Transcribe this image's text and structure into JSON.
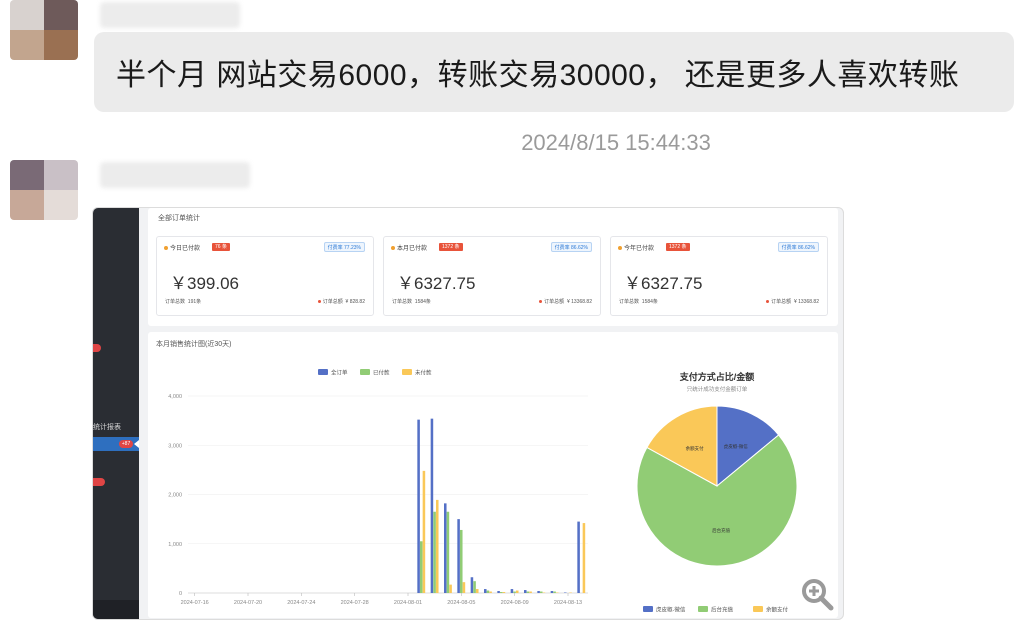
{
  "chat": {
    "message_text": "半个月 网站交易6000，转账交易30000， 还是更多人喜欢转账",
    "timestamp": "2024/8/15 15:44:33"
  },
  "screenshot": {
    "top_panel_title": "全部订单统计",
    "cards": [
      {
        "label": "今日已付款",
        "badge": "76 条",
        "rate": "付费率 77.23%",
        "amount": "￥399.06",
        "count_label": "订单总数",
        "count_value": "191条",
        "total_label": "订单总额",
        "total_value": "¥ 828.82"
      },
      {
        "label": "本月已付款",
        "badge": "1372 条",
        "rate": "付费率 86.62%",
        "amount": "￥6327.75",
        "count_label": "订单总数",
        "count_value": "1584条",
        "total_label": "订单总额",
        "total_value": "¥ 13368.82"
      },
      {
        "label": "今年已付款",
        "badge": "1372 条",
        "rate": "付费率 86.62%",
        "amount": "￥6327.75",
        "count_label": "订单总数",
        "count_value": "1584条",
        "total_label": "订单总额",
        "total_value": "¥ 13368.82"
      }
    ],
    "chart_panel_title": "本月销售统计图(近30天)",
    "sidebar": {
      "item_label": "统计报表",
      "badge_text": "+87"
    }
  },
  "chart_data": [
    {
      "type": "bar",
      "legend_position": "top-center",
      "series": [
        {
          "name": "全订单",
          "color": "#5470c6",
          "values": [
            0,
            0,
            0,
            0,
            0,
            0,
            0,
            0,
            0,
            0,
            0,
            0,
            0,
            0,
            0,
            0,
            0,
            3520,
            3540,
            1820,
            1500,
            320,
            80,
            40,
            80,
            60,
            40,
            40,
            10,
            1450
          ]
        },
        {
          "name": "已付款",
          "color": "#91cc75",
          "values": [
            0,
            0,
            0,
            0,
            0,
            0,
            0,
            0,
            0,
            0,
            0,
            0,
            0,
            0,
            0,
            0,
            0,
            1050,
            1650,
            1650,
            1280,
            240,
            50,
            20,
            30,
            30,
            30,
            30,
            0,
            0
          ]
        },
        {
          "name": "未付款",
          "color": "#fac858",
          "values": [
            0,
            0,
            0,
            0,
            0,
            0,
            0,
            0,
            0,
            0,
            0,
            0,
            0,
            0,
            0,
            0,
            0,
            2480,
            1890,
            170,
            220,
            80,
            30,
            20,
            50,
            30,
            10,
            10,
            10,
            1420
          ]
        }
      ],
      "x_ticks": [
        "2024-07-16",
        "2024-07-20",
        "2024-07-24",
        "2024-07-28",
        "2024-08-01",
        "2024-08-05",
        "2024-08-09",
        "2024-08-13"
      ],
      "y_ticks": [
        "0",
        "1,000",
        "2,000",
        "3,000",
        "4,000"
      ],
      "ylim": [
        0,
        4000
      ],
      "grid": true
    },
    {
      "type": "pie",
      "title": "支付方式占比/金额",
      "subtitle": "只统计成功支付金额订单",
      "legend_position": "bottom",
      "slices": [
        {
          "name": "虎皮椒-微信",
          "value": 14,
          "color": "#5470c6"
        },
        {
          "name": "后台充值",
          "value": 69,
          "color": "#91cc75"
        },
        {
          "name": "余额支付",
          "value": 17,
          "color": "#fac858"
        }
      ]
    }
  ]
}
